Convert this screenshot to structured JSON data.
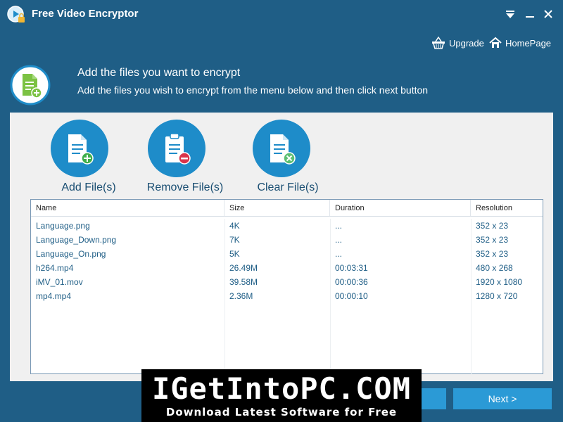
{
  "app": {
    "title": "Free Video Encryptor"
  },
  "top_links": {
    "upgrade": "Upgrade",
    "homepage": "HomePage"
  },
  "header": {
    "title": "Add the files you want to encrypt",
    "subtitle": "Add the files you wish to encrypt from the menu below and then click next button"
  },
  "actions": {
    "add": "Add File(s)",
    "remove": "Remove File(s)",
    "clear": "Clear File(s)"
  },
  "table": {
    "columns": [
      "Name",
      "Size",
      "Duration",
      "Resolution"
    ],
    "rows": [
      [
        "Language.png",
        "4K",
        "...",
        "352 x 23"
      ],
      [
        "Language_Down.png",
        "7K",
        "...",
        "352 x 23"
      ],
      [
        "Language_On.png",
        "5K",
        "...",
        "352 x 23"
      ],
      [
        "h264.mp4",
        "26.49M",
        "00:03:31",
        "480 x 268"
      ],
      [
        "iMV_01.mov",
        "39.58M",
        "00:00:36",
        "1920 x 1080"
      ],
      [
        "mp4.mp4",
        "2.36M",
        "00:00:10",
        "1280 x 720"
      ]
    ]
  },
  "buttons": {
    "next": "Next >"
  },
  "watermark": {
    "line1": "IGetIntoPC.COM",
    "line2": "Download Latest Software for Free"
  },
  "colors": {
    "background": "#1f5e86",
    "accent": "#1e8cc9",
    "button": "#2b9ad6"
  }
}
